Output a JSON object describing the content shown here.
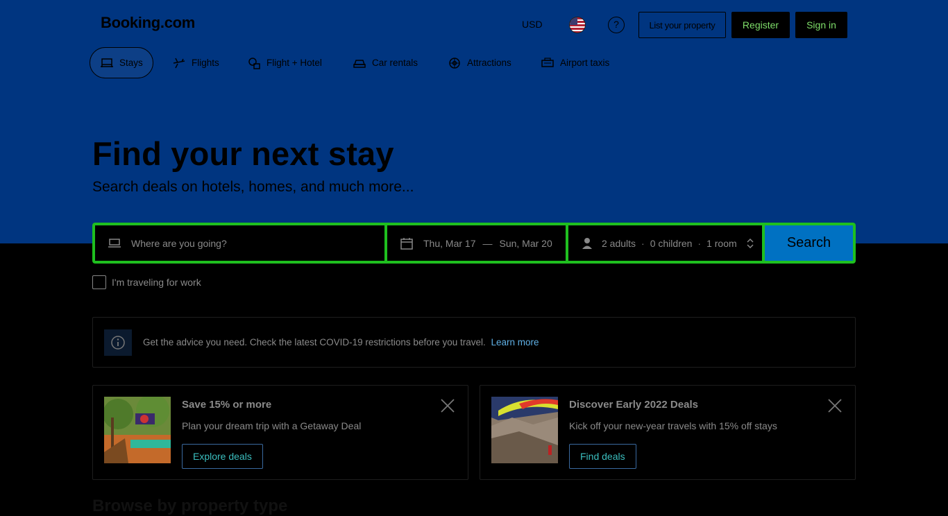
{
  "header": {
    "logo": "Booking.com",
    "currency": "USD",
    "flag_icon": "us-flag-icon",
    "help_icon": "help-icon",
    "help_glyph": "?",
    "list_property": "List your property",
    "register": "Register",
    "sign_in": "Sign in"
  },
  "nav": {
    "items": [
      {
        "label": "Stays",
        "icon": "bed-icon",
        "active": true
      },
      {
        "label": "Flights",
        "icon": "plane-icon"
      },
      {
        "label": "Flight + Hotel",
        "icon": "flight-hotel-icon"
      },
      {
        "label": "Car rentals",
        "icon": "car-icon"
      },
      {
        "label": "Attractions",
        "icon": "attractions-icon"
      },
      {
        "label": "Airport taxis",
        "icon": "taxi-icon"
      }
    ]
  },
  "hero": {
    "title": "Find your next stay",
    "subtitle": "Search deals on hotels, homes, and much more..."
  },
  "search": {
    "destination_placeholder": "Where are you going?",
    "checkin": "Thu, Mar 17",
    "checkout": "Sun, Mar 20",
    "dash": "—",
    "adults": "2 adults",
    "children": "0 children",
    "rooms": "1 room",
    "separator": "·",
    "button": "Search"
  },
  "work_travel": {
    "label": "I'm traveling for work"
  },
  "notice": {
    "text": "Get the advice you need. Check the latest COVID-19 restrictions before you travel.",
    "link": "Learn more"
  },
  "cards": [
    {
      "title": "Save 15% or more",
      "description": "Plan your dream trip with a Getaway Deal",
      "button": "Explore deals"
    },
    {
      "title": "Discover Early 2022 Deals",
      "description": "Kick off your new-year travels with 15% off stays",
      "button": "Find deals"
    }
  ],
  "section_heading_partial": "Browse by property type",
  "colors": {
    "hero_bg": "#003580",
    "search_border": "#1fbf1f",
    "search_button": "#0071c2",
    "link": "#5fb0e5",
    "accent_green": "#7fdf6a"
  }
}
